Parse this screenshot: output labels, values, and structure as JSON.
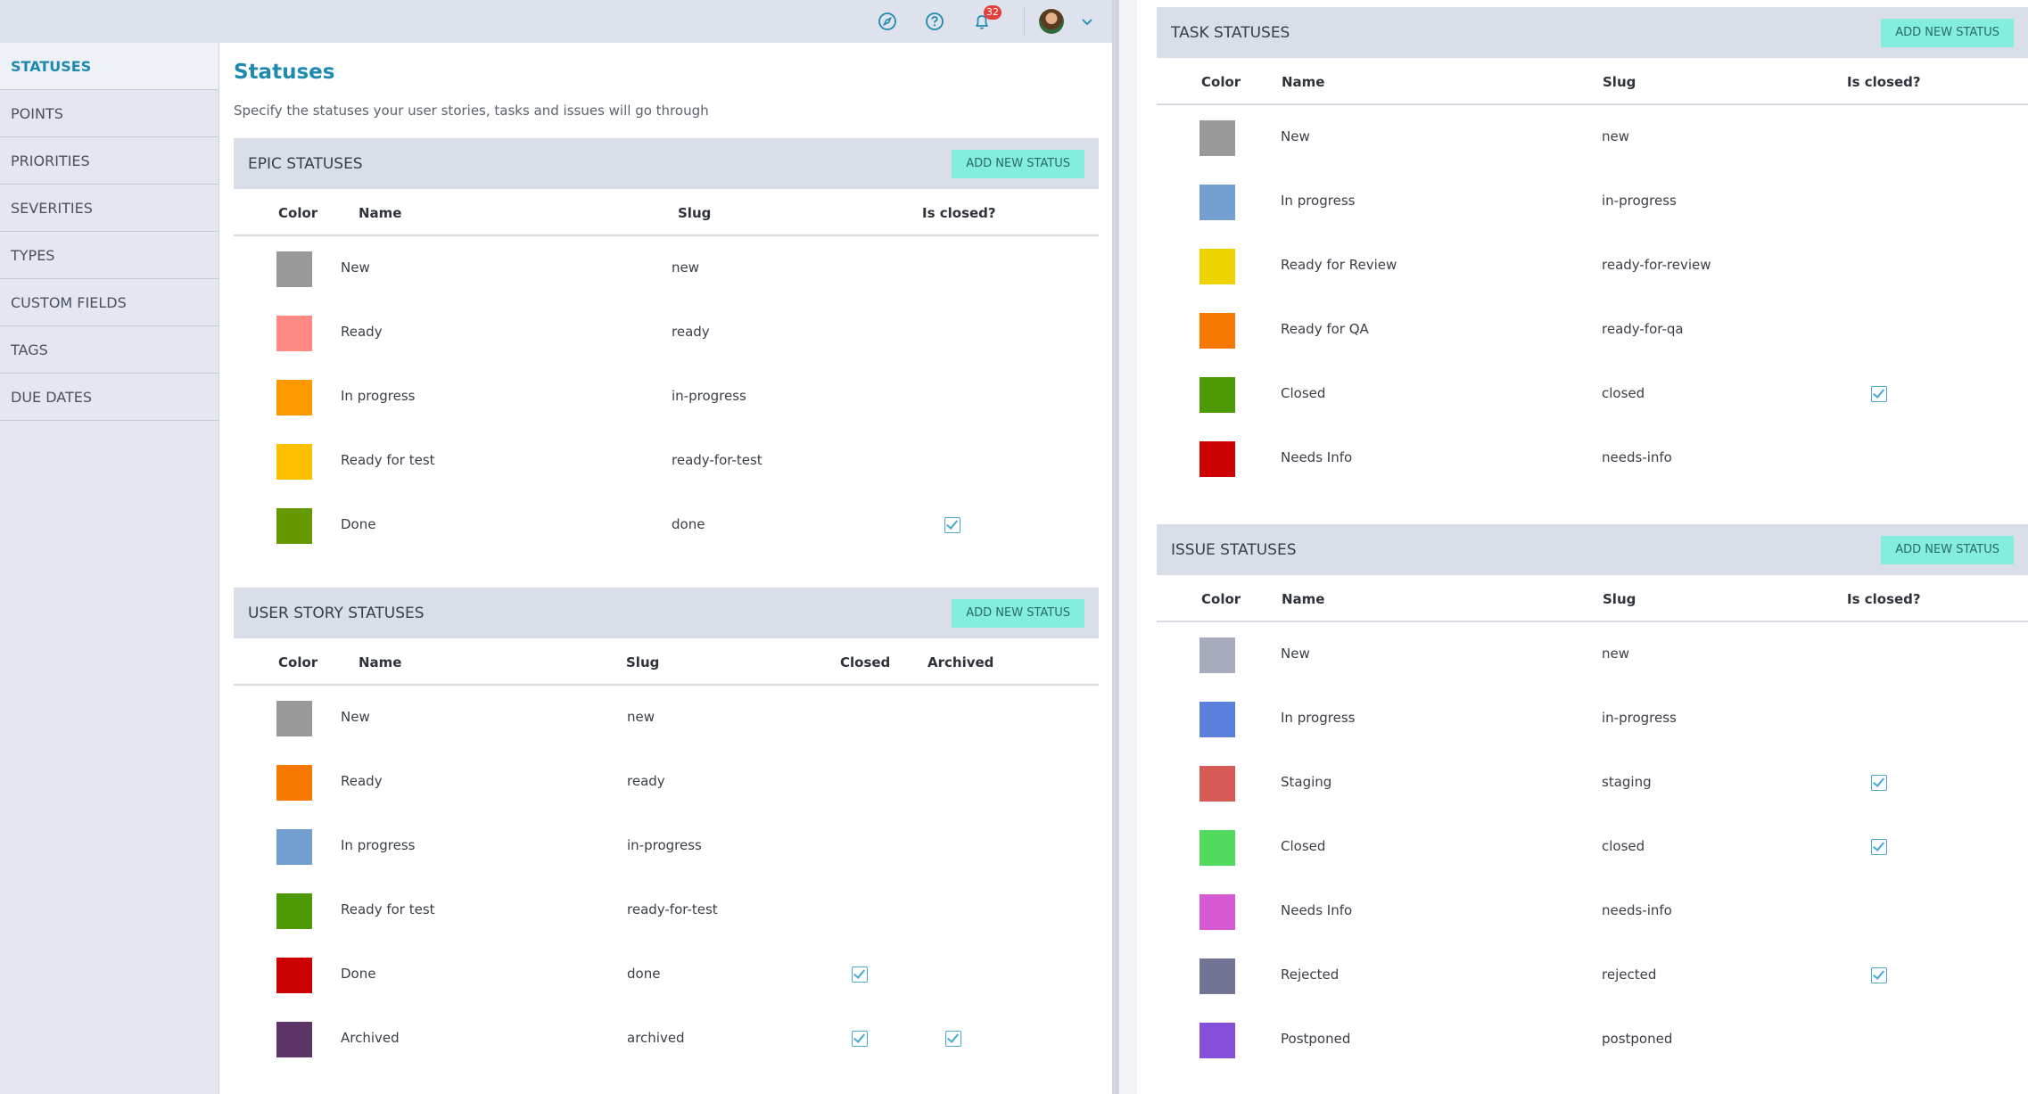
{
  "topbar": {
    "notification_count": "32"
  },
  "sidebar": {
    "items": [
      {
        "label": "STATUSES"
      },
      {
        "label": "POINTS"
      },
      {
        "label": "PRIORITIES"
      },
      {
        "label": "SEVERITIES"
      },
      {
        "label": "TYPES"
      },
      {
        "label": "CUSTOM FIELDS"
      },
      {
        "label": "TAGS"
      },
      {
        "label": "DUE DATES"
      }
    ]
  },
  "main": {
    "title": "Statuses",
    "description": "Specify the statuses your user stories, tasks and issues will go through"
  },
  "epic": {
    "title": "EPIC STATUSES",
    "add_label": "ADD NEW STATUS",
    "col_color": "Color",
    "col_name": "Name",
    "col_slug": "Slug",
    "col_closed": "Is closed?",
    "rows": [
      {
        "name": "New",
        "slug": "new",
        "color": "#999999",
        "closed": false
      },
      {
        "name": "Ready",
        "slug": "ready",
        "color": "#ff8a84",
        "closed": false
      },
      {
        "name": "In progress",
        "slug": "in-progress",
        "color": "#ff9900",
        "closed": false
      },
      {
        "name": "Ready for test",
        "slug": "ready-for-test",
        "color": "#fcc000",
        "closed": false
      },
      {
        "name": "Done",
        "slug": "done",
        "color": "#669900",
        "closed": true
      }
    ]
  },
  "userstory": {
    "title": "USER STORY STATUSES",
    "add_label": "ADD NEW STATUS",
    "col_color": "Color",
    "col_name": "Name",
    "col_slug": "Slug",
    "col_closed": "Closed",
    "col_archived": "Archived",
    "rows": [
      {
        "name": "New",
        "slug": "new",
        "color": "#999999",
        "closed": false,
        "archived": false
      },
      {
        "name": "Ready",
        "slug": "ready",
        "color": "#f57900",
        "closed": false,
        "archived": false
      },
      {
        "name": "In progress",
        "slug": "in-progress",
        "color": "#729fcf",
        "closed": false,
        "archived": false
      },
      {
        "name": "Ready for test",
        "slug": "ready-for-test",
        "color": "#4e9a06",
        "closed": false,
        "archived": false
      },
      {
        "name": "Done",
        "slug": "done",
        "color": "#cc0000",
        "closed": true,
        "archived": false
      },
      {
        "name": "Archived",
        "slug": "archived",
        "color": "#5c3566",
        "closed": true,
        "archived": true
      }
    ]
  },
  "task": {
    "title": "TASK STATUSES",
    "add_label": "ADD NEW STATUS",
    "col_color": "Color",
    "col_name": "Name",
    "col_slug": "Slug",
    "col_closed": "Is closed?",
    "rows": [
      {
        "name": "New",
        "slug": "new",
        "color": "#999999",
        "closed": false
      },
      {
        "name": "In progress",
        "slug": "in-progress",
        "color": "#729fcf",
        "closed": false
      },
      {
        "name": "Ready for Review",
        "slug": "ready-for-review",
        "color": "#edd400",
        "closed": false
      },
      {
        "name": "Ready for QA",
        "slug": "ready-for-qa",
        "color": "#f57900",
        "closed": false
      },
      {
        "name": "Closed",
        "slug": "closed",
        "color": "#4e9a06",
        "closed": true
      },
      {
        "name": "Needs Info",
        "slug": "needs-info",
        "color": "#cc0000",
        "closed": false
      }
    ]
  },
  "issue": {
    "title": "ISSUE STATUSES",
    "add_label": "ADD NEW STATUS",
    "col_color": "Color",
    "col_name": "Name",
    "col_slug": "Slug",
    "col_closed": "Is closed?",
    "rows": [
      {
        "name": "New",
        "slug": "new",
        "color": "#a8aabd",
        "closed": false
      },
      {
        "name": "In progress",
        "slug": "in-progress",
        "color": "#5b7fdc",
        "closed": false
      },
      {
        "name": "Staging",
        "slug": "staging",
        "color": "#d65b56",
        "closed": true
      },
      {
        "name": "Closed",
        "slug": "closed",
        "color": "#52da5e",
        "closed": true
      },
      {
        "name": "Needs Info",
        "slug": "needs-info",
        "color": "#d55ad4",
        "closed": false
      },
      {
        "name": "Rejected",
        "slug": "rejected",
        "color": "#737597",
        "closed": true
      },
      {
        "name": "Postponed",
        "slug": "postponed",
        "color": "#854fd9",
        "closed": false
      }
    ]
  }
}
